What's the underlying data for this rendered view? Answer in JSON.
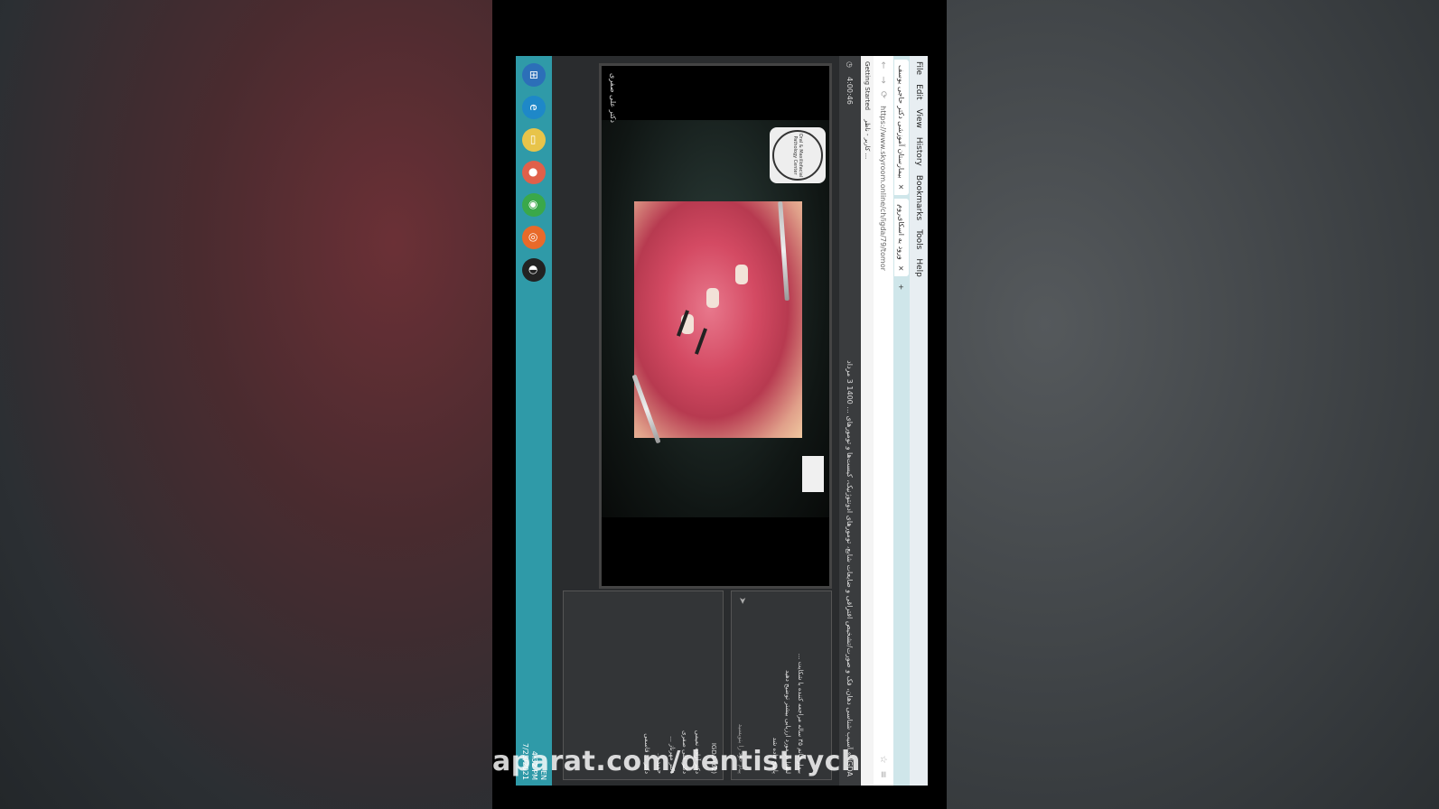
{
  "browser": {
    "menu": [
      "File",
      "Edit",
      "View",
      "History",
      "Bookmarks",
      "Tools",
      "Help"
    ],
    "tab_title": "بیمارستان آموزشی دکتر حاجی یوسف",
    "tab2_title": "ورود به اسکای‌روم",
    "url": "https://www.skyroom.online/ch/igda/79/tomor",
    "bookmark": "Getting Started",
    "bookmark2": "کاربر - ناظر ..."
  },
  "app": {
    "timer": "4:00:46",
    "title": "IGDA » آسیب شناسی دهان، فک و صورت/تشخیص افتراقی و ضایعات شایع، تومورهای ادونتوژنیک، کیست‌ها و تومورهای ... 1400 3 مرداد",
    "presenter": "دکتر علی صفری"
  },
  "video": {
    "seal_text": "Oral & Maxillofacial Pathology Center"
  },
  "chat": {
    "messages": [
      "بیمار خانم ۳۵ ساله مراجعه کننده با شکایت ...",
      "لطفا در مورد ارزیابی بیشتر توضیح دهید",
      "پاسخ داده شد"
    ],
    "input_placeholder": "پیام خود را بنویسید"
  },
  "users": {
    "header": "IGDA (62)",
    "list": [
      "دکتر آزاده نعیمی",
      "دکتر علی صفری",
      "دکتر مهرناز ...",
      "حمید ...",
      "دکتر ... قاسمی"
    ]
  },
  "taskbar": {
    "lang": "EN",
    "time": "4:32 PM",
    "date": "7/25/2021",
    "icons": [
      "windows-start",
      "ie",
      "folder",
      "app",
      "chrome",
      "firefox",
      "obs"
    ]
  },
  "watermark": "aparat.com/dentistrych"
}
